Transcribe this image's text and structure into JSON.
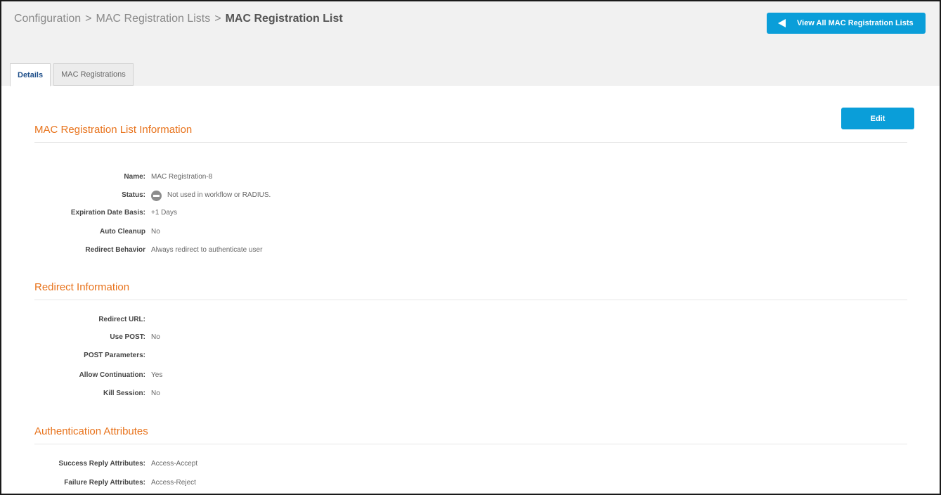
{
  "breadcrumb": {
    "items": [
      "Configuration",
      "MAC Registration Lists"
    ],
    "separator": ">",
    "current": "MAC Registration List"
  },
  "header": {
    "view_all_label": "View All MAC Registration Lists"
  },
  "tabs": [
    {
      "label": "Details",
      "active": true
    },
    {
      "label": "MAC Registrations",
      "active": false
    }
  ],
  "edit_label": "Edit",
  "sections": {
    "list_info": {
      "title": "MAC Registration List Information",
      "fields": [
        {
          "label": "Name:",
          "value": "MAC Registration-8"
        },
        {
          "label": "Status:",
          "value": "Not used in workflow or RADIUS."
        },
        {
          "label": "Expiration Date Basis:",
          "value": "+1 Days"
        },
        {
          "label": "Auto Cleanup",
          "value": "No"
        },
        {
          "label": "Redirect Behavior",
          "value": "Always redirect to authenticate user"
        }
      ]
    },
    "redirect_info": {
      "title": "Redirect Information",
      "fields": [
        {
          "label": "Redirect URL:",
          "value": ""
        },
        {
          "label": "Use POST:",
          "value": "No"
        },
        {
          "label": "POST Parameters:",
          "value": ""
        },
        {
          "label": "Allow Continuation:",
          "value": "Yes"
        },
        {
          "label": "Kill Session:",
          "value": "No"
        }
      ]
    },
    "auth_attrs": {
      "title": "Authentication Attributes",
      "fields": [
        {
          "label": "Success Reply Attributes:",
          "value": "Access-Accept"
        },
        {
          "label": "Failure Reply Attributes:",
          "value": "Access-Reject"
        }
      ]
    }
  },
  "colors": {
    "accent": "#0a9ed9",
    "section_title": "#e8731c",
    "tab_active": "#1f4f8a",
    "status_icon": "#8c8c8c"
  },
  "icons": {
    "back": "arrow-left-icon",
    "status": "minus-circle-icon"
  }
}
